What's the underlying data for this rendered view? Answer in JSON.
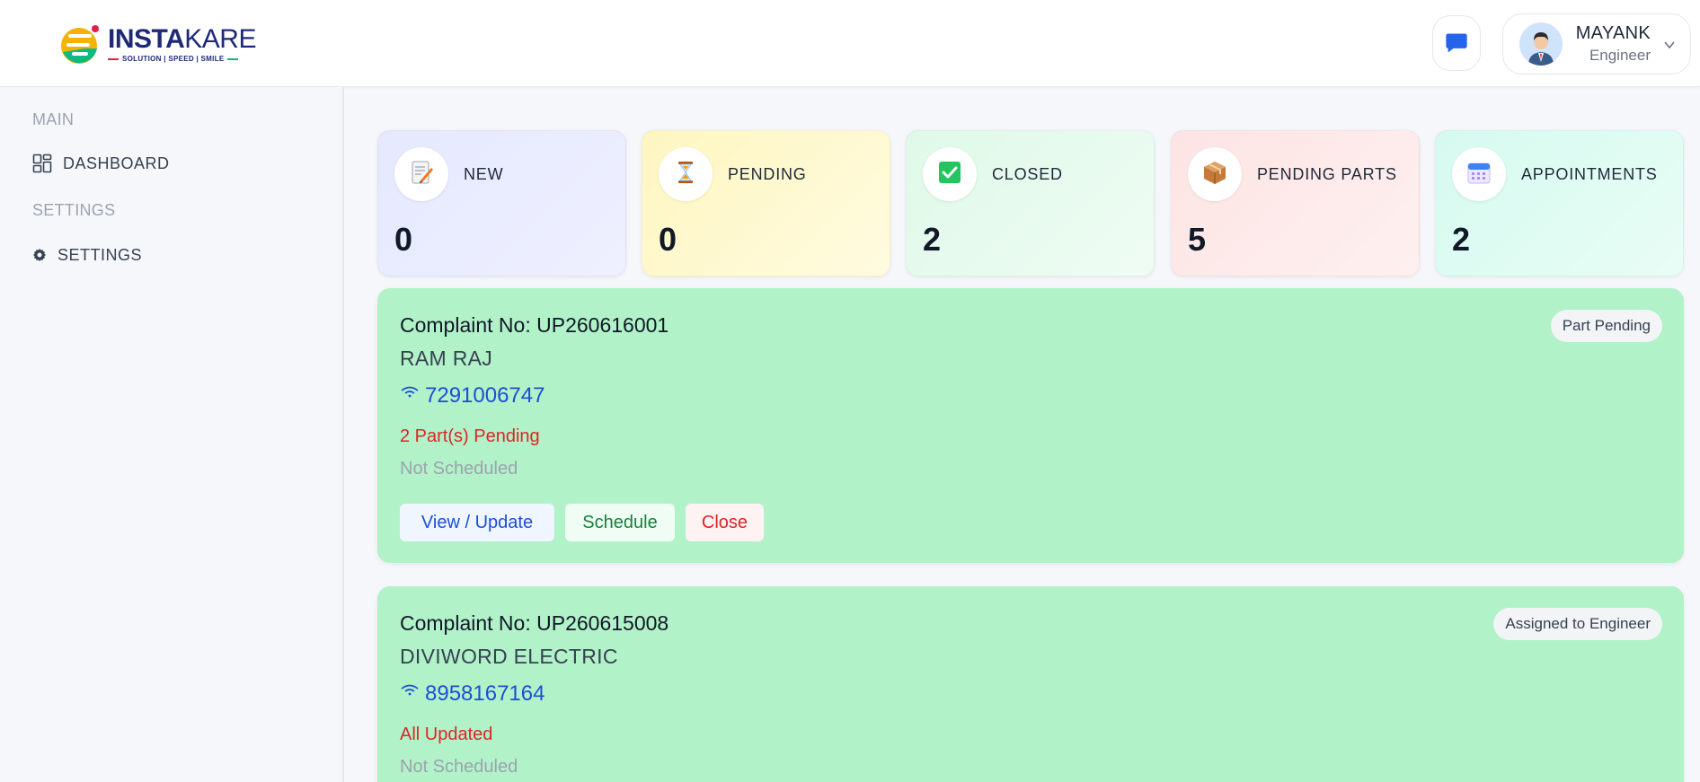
{
  "brand": {
    "name_part1": "INSTA",
    "name_part2": "KARE",
    "tagline": "SOLUTION | SPEED | SMILE"
  },
  "header": {
    "user_name": "MAYANK",
    "user_role": "Engineer",
    "icons": {
      "chat": "chat-icon",
      "chevron": "chevron-down-icon"
    }
  },
  "sidebar": {
    "sections": [
      {
        "label": "MAIN",
        "items": [
          {
            "label": "DASHBOARD",
            "icon": "grid-icon"
          }
        ]
      },
      {
        "label": "SETTINGS",
        "items": [
          {
            "label": "SETTINGS",
            "icon": "gear-icon"
          }
        ]
      }
    ]
  },
  "stats": [
    {
      "label": "NEW",
      "count": "0",
      "icon": "memo-icon",
      "bg": "#e8ebff"
    },
    {
      "label": "PENDING",
      "count": "0",
      "icon": "hourglass-icon",
      "bg": "#fef9c3"
    },
    {
      "label": "CLOSED",
      "count": "2",
      "icon": "check-box-icon",
      "bg": "#e6fbee"
    },
    {
      "label": "PENDING PARTS",
      "count": "5",
      "icon": "package-icon",
      "bg": "#fdecec"
    },
    {
      "label": "APPOINTMENTS",
      "count": "2",
      "icon": "calendar-icon",
      "bg": "#dcfbf2"
    }
  ],
  "complaints": [
    {
      "number": "Complaint No: UP260616001",
      "customer": "RAM RAJ",
      "phone": "7291006747",
      "parts_status": "2 Part(s) Pending",
      "schedule_status": "Not Scheduled",
      "badge": "Part Pending",
      "actions": {
        "view": "View / Update",
        "schedule": "Schedule",
        "close": "Close"
      }
    },
    {
      "number": "Complaint No: UP260615008",
      "customer": "DIVIWORD ELECTRIC",
      "phone": "8958167164",
      "parts_status": "All Updated",
      "schedule_status": "Not Scheduled",
      "badge": "Assigned to Engineer"
    }
  ],
  "colors": {
    "card_bg": "#b1f2c8",
    "link": "#1d4ed8",
    "danger": "#dc2626",
    "success": "#15803d"
  }
}
